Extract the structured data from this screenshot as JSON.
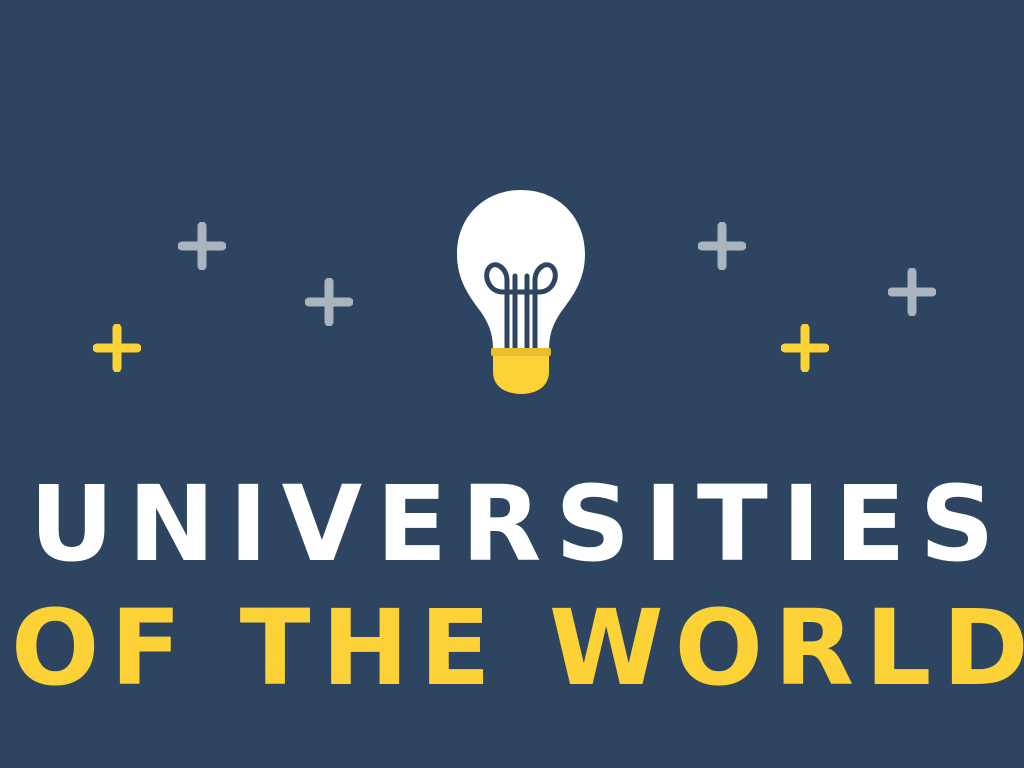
{
  "title": {
    "line1": "UNIVERSITIES",
    "line2": "OF THE WORLD"
  },
  "colors": {
    "background": "#2d4560",
    "white": "#ffffff",
    "yellow": "#fdd236",
    "grey": "#aab4bf",
    "bulb_filament": "#2d4560"
  },
  "icons": {
    "bulb": "lightbulb-icon",
    "sparkle_grey": "plus-sparkle-icon",
    "sparkle_yellow": "plus-sparkle-icon"
  }
}
